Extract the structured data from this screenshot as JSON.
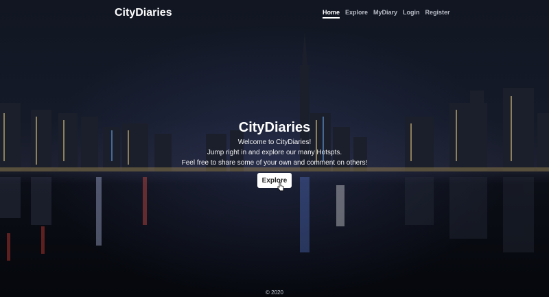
{
  "nav": {
    "brand": "CityDiaries",
    "links": [
      "Home",
      "Explore",
      "MyDiary",
      "Login",
      "Register"
    ]
  },
  "hero": {
    "title": "CityDiaries",
    "lines": [
      "Welcome to CityDiaries!",
      "Jump right in and explore our many Hotspts.",
      "Feel free to share some of your own and comment on others!"
    ],
    "button_label": "Explore"
  },
  "footer": {
    "copyright": "© 2020"
  }
}
